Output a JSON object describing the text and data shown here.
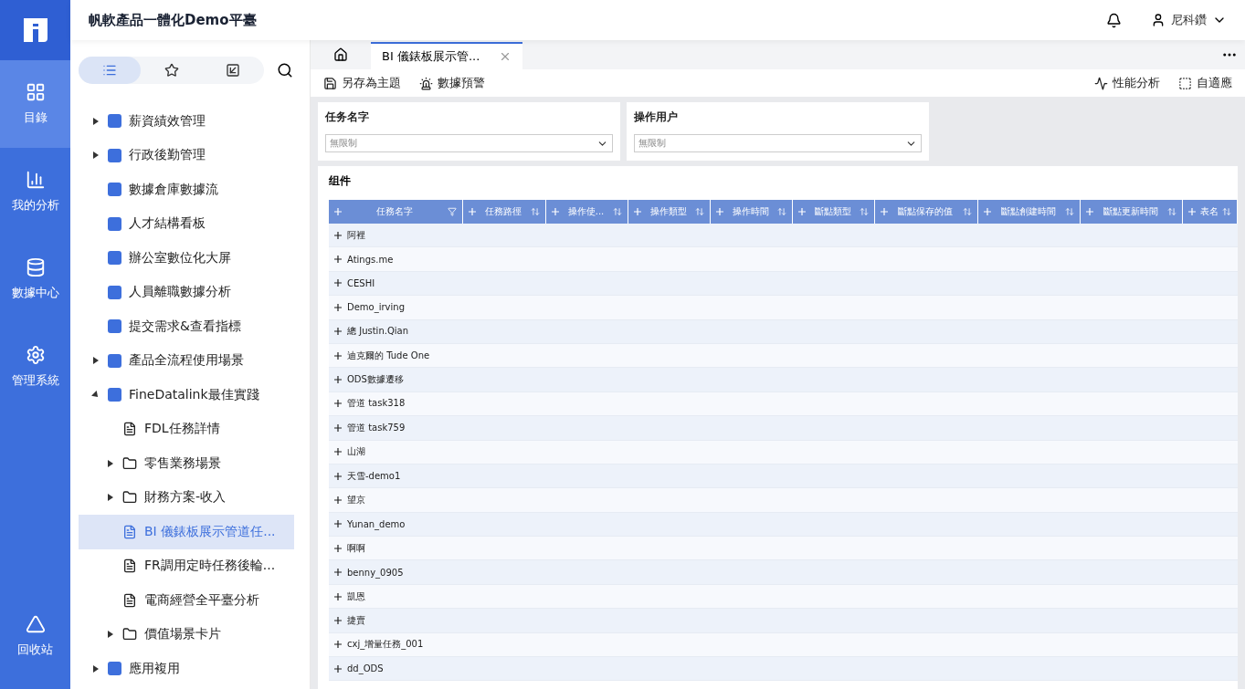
{
  "app": {
    "title": "帆軟產品一體化Demo平臺",
    "user": "尼科鑽"
  },
  "rail": [
    {
      "label": "目錄",
      "selected": true
    },
    {
      "label": "我的分析",
      "selected": false
    },
    {
      "label": "數據中心",
      "selected": false
    },
    {
      "label": "管理系統",
      "selected": false
    },
    {
      "label": "回收站",
      "selected": false
    }
  ],
  "sidebar_tabs": [
    {
      "selected": true
    },
    {
      "selected": false
    },
    {
      "selected": false
    }
  ],
  "tree": [
    {
      "label": "薪資績效管理",
      "kind": "app",
      "expanded": false
    },
    {
      "label": "行政後勤管理",
      "kind": "app",
      "expanded": false
    },
    {
      "label": "數據倉庫數據流",
      "kind": "app"
    },
    {
      "label": "人才結構看板",
      "kind": "app"
    },
    {
      "label": "辦公室數位化大屏",
      "kind": "app"
    },
    {
      "label": "人員離職數據分析",
      "kind": "app"
    },
    {
      "label": "提交需求&查看指標",
      "kind": "app"
    },
    {
      "label": "產品全流程使用場景",
      "kind": "app",
      "expanded": false
    },
    {
      "label": "FineDatalink最佳實踐",
      "kind": "app",
      "expanded": true,
      "children": [
        {
          "label": "FDL任務詳情",
          "kind": "doc",
          "selected": false
        },
        {
          "label": "零售業務場景",
          "kind": "folder",
          "expanded": false
        },
        {
          "label": "財務方案-收入",
          "kind": "folder",
          "expanded": false
        },
        {
          "label": "BI 儀錶板展示管道任...",
          "kind": "doc",
          "selected": true
        },
        {
          "label": "FR調用定時任務後輪...",
          "kind": "doc",
          "selected": false
        },
        {
          "label": "電商經營全平臺分析",
          "kind": "doc",
          "selected": false
        },
        {
          "label": "價值場景卡片",
          "kind": "folder",
          "expanded": false
        }
      ]
    },
    {
      "label": "應用複用",
      "kind": "app",
      "expanded": false
    }
  ],
  "tabs": [
    {
      "label": "BI 儀錶板展示管...",
      "selected": true
    }
  ],
  "toolbar_left": [
    "另存為主題",
    "數據預警"
  ],
  "toolbar_right": [
    "性能分析",
    "自適應"
  ],
  "filters": [
    {
      "label": "任务名字",
      "placeholder": "無限制"
    },
    {
      "label": "操作用户",
      "placeholder": "無限制"
    }
  ],
  "table": {
    "title": "组件",
    "columns": [
      "任務名字",
      "任務路徑",
      "操作使...",
      "操作類型",
      "操作時間",
      "斷點類型",
      "斷點保存的值",
      "斷點創建時間",
      "斷點更新時間",
      "表名"
    ],
    "rows": [
      "阿裡",
      "Atings.me",
      "CESHI",
      "Demo_irving",
      "總 Justin.Qian",
      "迪克爾的 Tude One",
      "ODS數據遷移",
      "管道 task318",
      "管道 task759",
      "山湖",
      "天雪-demo1",
      "望京",
      "Yunan_demo",
      "啊啊",
      "benny_0905",
      "凱恩",
      "捷賣",
      "cxj_增量任務_001",
      "dd_ODS"
    ]
  }
}
